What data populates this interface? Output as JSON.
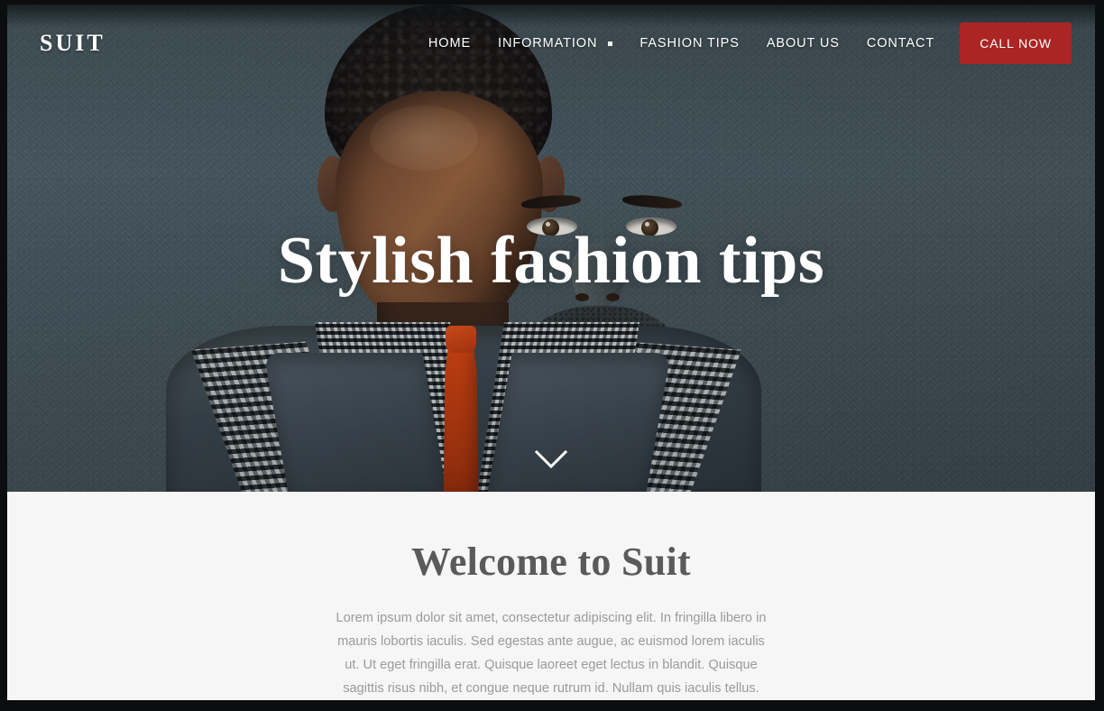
{
  "site": {
    "logo": "SUIT"
  },
  "nav": {
    "items": [
      {
        "label": "HOME",
        "has_dropdown": false
      },
      {
        "label": "INFORMATION",
        "has_dropdown": true
      },
      {
        "label": "FASHION TIPS",
        "has_dropdown": false
      },
      {
        "label": "ABOUT US",
        "has_dropdown": false
      },
      {
        "label": "CONTACT",
        "has_dropdown": false
      }
    ],
    "cta_label": "CALL NOW",
    "cta_color": "#ab2525"
  },
  "hero": {
    "title": "Stylish fashion tips",
    "scroll_hint_icon": "chevron-down-icon",
    "image_alt": "Man in grey waistcoat, checkered shirt and orange tie against a slate wall",
    "background_color": "#46565d"
  },
  "welcome": {
    "title": "Welcome to Suit",
    "paragraph": "Lorem ipsum dolor sit amet, consectetur adipiscing elit. In fringilla libero in mauris lobortis iaculis. Sed egestas ante augue, ac euismod lorem iaculis ut. Ut eget fringilla erat. Quisque laoreet eget lectus in blandit. Quisque sagittis risus nibh, et congue neque rutrum id. Nullam quis iaculis tellus.",
    "background_color": "#f6f6f6",
    "title_color": "#5a5a5a",
    "text_color": "#9a9a9a"
  }
}
